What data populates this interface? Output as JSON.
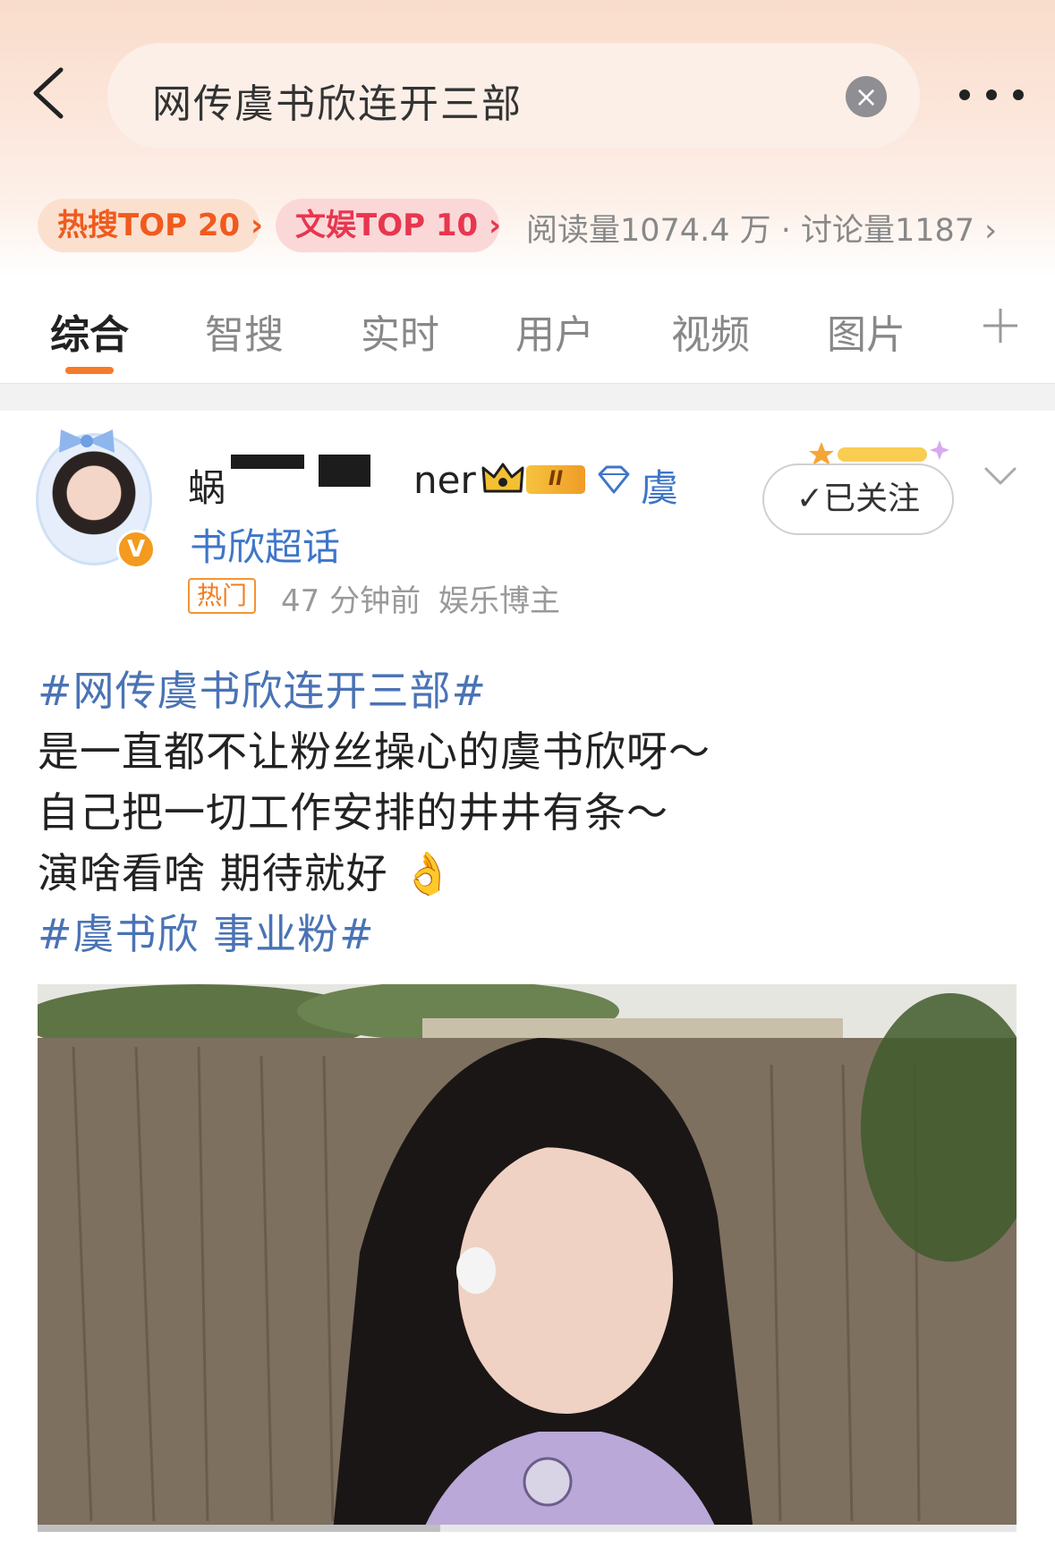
{
  "search": {
    "query": "网传虞书欣连开三部"
  },
  "trends": {
    "hot": "热搜TOP 20",
    "ent": "文娱TOP 10",
    "stats": "阅读量1074.4 万 · 讨论量1187"
  },
  "tabs": [
    "综合",
    "智搜",
    "实时",
    "用户",
    "视频",
    "图片"
  ],
  "post": {
    "username_start": "蜗",
    "username_end": "ner",
    "level": "II",
    "chaohua_a": "虞",
    "chaohua_b": "书欣超话",
    "hot_tag": "热门",
    "time": "47 分钟前",
    "role": "娱乐博主",
    "follow_label": "✓已关注",
    "lines": [
      "#网传虞书欣连开三部#",
      "是一直都不让粉丝操心的虞书欣呀～",
      "自己把一切工作安排的井井有条～",
      "演啥看啥 期待就好",
      "#虞书欣 事业粉#"
    ],
    "emoji": "👌"
  },
  "colors": {
    "accent": "#f77a2a",
    "hot_chip": "#f05a1e",
    "ent_chip": "#e8364f",
    "link": "#4a73b5",
    "topic": "#3e76c8"
  },
  "icons": [
    "back-icon",
    "clear-icon",
    "more-icon",
    "plus-icon",
    "crown-icon",
    "diamond-icon",
    "chevron-down-icon",
    "verified-icon"
  ]
}
